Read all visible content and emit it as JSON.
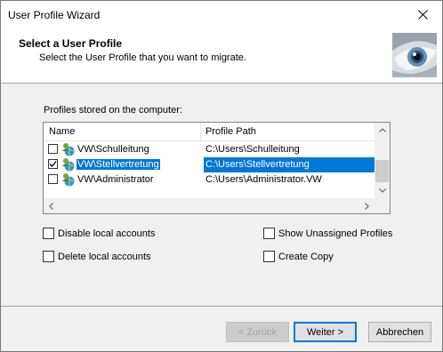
{
  "window": {
    "title": "User Profile Wizard"
  },
  "header": {
    "title": "Select a User Profile",
    "subtitle": "Select the User Profile that you want to migrate."
  },
  "profiles": {
    "label": "Profiles stored on the computer:",
    "columns": [
      "Name",
      "Profile Path"
    ],
    "rows": [
      {
        "name": "VW\\Schulleitung",
        "path": "C:\\Users\\Schulleitung",
        "checked": false,
        "selected": false
      },
      {
        "name": "VW\\Stellvertretung",
        "path": "C:\\Users\\Stellvertretung",
        "checked": true,
        "selected": true
      },
      {
        "name": "VW\\Administrator",
        "path": "C:\\Users\\Administrator.VW",
        "checked": false,
        "selected": false
      }
    ]
  },
  "options": {
    "disable_local": "Disable local accounts",
    "delete_local": "Delete local accounts",
    "show_unassigned": "Show Unassigned Profiles",
    "create_copy": "Create Copy"
  },
  "buttons": {
    "back": "< Zurück",
    "next": "Weiter >",
    "cancel": "Abbrechen"
  },
  "colors": {
    "selection": "#0078d7",
    "accent_border": "#0078d7"
  }
}
